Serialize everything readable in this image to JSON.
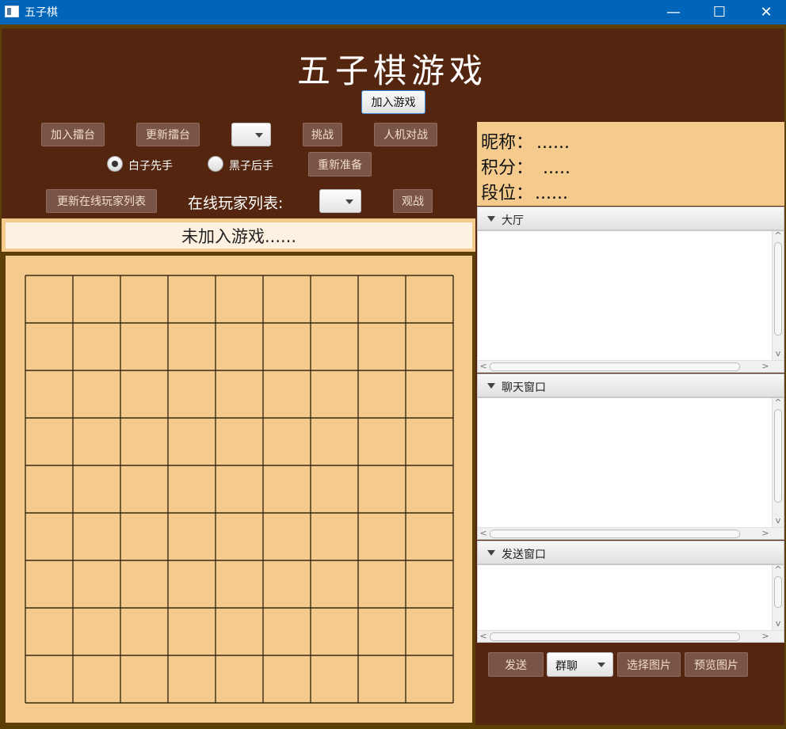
{
  "window": {
    "title": "五子棋",
    "controls": {
      "minimize": "—",
      "maximize": "☐",
      "close": "✕"
    }
  },
  "header": {
    "title": "五子棋游戏",
    "join_button": "加入游戏"
  },
  "toolbar": {
    "join_arena": "加入擂台",
    "update_arena": "更新擂台",
    "challenge": "挑战",
    "pve": "人机对战",
    "white_first": "白子先手",
    "black_second": "黑子后手",
    "white_first_selected": true,
    "reset_ready": "重新准备",
    "refresh_online": "更新在线玩家列表",
    "online_label": "在线玩家列表:",
    "spectate": "观战"
  },
  "status": {
    "text": "未加入游戏......"
  },
  "board": {
    "rows": 9,
    "cols": 9,
    "grid_color": "#3a2a14",
    "background": "#f4cb8c"
  },
  "profile": {
    "nickname_label": "昵称：",
    "nickname_value": "......",
    "score_label": "积分：",
    "score_value": ".....",
    "rank_label": "段位：",
    "rank_value": "......"
  },
  "panels": {
    "lobby": "大厅",
    "chat": "聊天窗口",
    "send": "发送窗口"
  },
  "chat_controls": {
    "send_button": "发送",
    "mode_value": "群聊",
    "choose_image": "选择图片",
    "preview_image": "预览图片"
  },
  "colors": {
    "background": "#55260f",
    "accent": "#f4cb8c",
    "button": "#7b5448",
    "titlebar": "#0065b8"
  }
}
